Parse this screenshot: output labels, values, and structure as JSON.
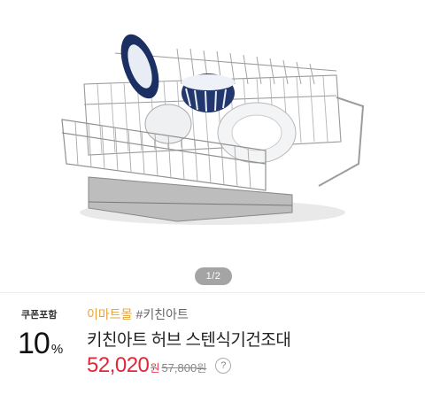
{
  "hero": {
    "image_icon": "dish-rack-photo",
    "pager_text": "1/2"
  },
  "product": {
    "coupon_label": "쿠폰포함",
    "discount_value": "10",
    "discount_unit": "%",
    "brand": "이마트몰",
    "tag": "#키친아트",
    "title": "키친아트 허브 스텐식기건조대",
    "price": "52,020",
    "price_unit": "원",
    "original_price": "57,800",
    "original_unit": "원",
    "help_icon": "question-icon",
    "help_glyph": "?"
  },
  "colors": {
    "brand": "#e8a33b",
    "price": "#e0283a"
  }
}
